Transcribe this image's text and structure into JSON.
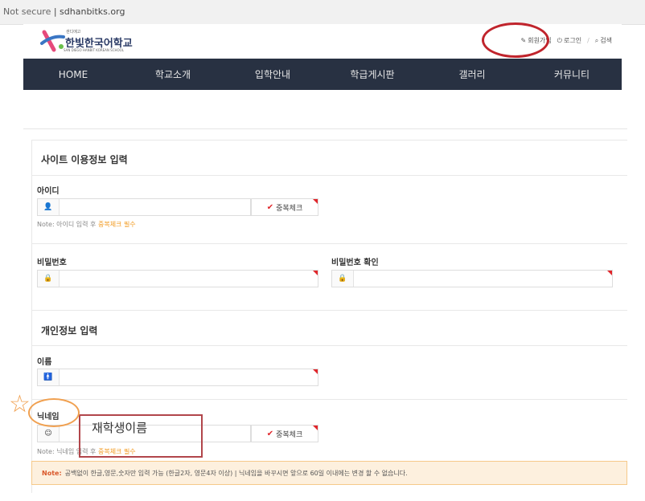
{
  "browser": {
    "security": "Not secure",
    "url": "sdhanbitks.org"
  },
  "logo": {
    "tagline": "샌디에고",
    "name": "한빛한국어학교",
    "subtitle": "SAN DIEGO HANBIT KOREAN SCHOOL"
  },
  "toplinks": {
    "join": "회원가입",
    "login": "로그인",
    "search": "검색",
    "sep": "/"
  },
  "nav": [
    "HOME",
    "학교소개",
    "입학안내",
    "학급게시판",
    "갤러리",
    "커뮤니티"
  ],
  "sections": {
    "site_info": "사이트 이용정보 입력",
    "personal_info": "개인정보 입력"
  },
  "fields": {
    "id_label": "아이디",
    "dup_check": "중복체크",
    "id_note_prefix": "Note: 아이디 입력 후",
    "id_note_highlight": "중복체크 필수",
    "password_label": "비밀번호",
    "password_confirm_label": "비밀번호 확인",
    "name_label": "이름",
    "nickname_label": "닉네임",
    "nick_note_prefix": "Note: 닉네임 입력 후",
    "nick_note_highlight": "중복체크 필수"
  },
  "notebox": {
    "label": "Note:",
    "text": "공백없이 한글,영문,숫자만 입력 가능 (한글2자, 영문4자 이상) | 닉네임을 바꾸시면 앞으로 60일 이내에는 변경 할 수 없습니다."
  },
  "annotation": {
    "handwritten": "재학생이름",
    "star": "☆"
  },
  "colors": {
    "nav_bg": "#283142",
    "required_marker": "#e0262b",
    "highlight_orange": "#f29a1f",
    "annotation_red": "#c0242c",
    "annotation_orange": "#f0a050"
  }
}
